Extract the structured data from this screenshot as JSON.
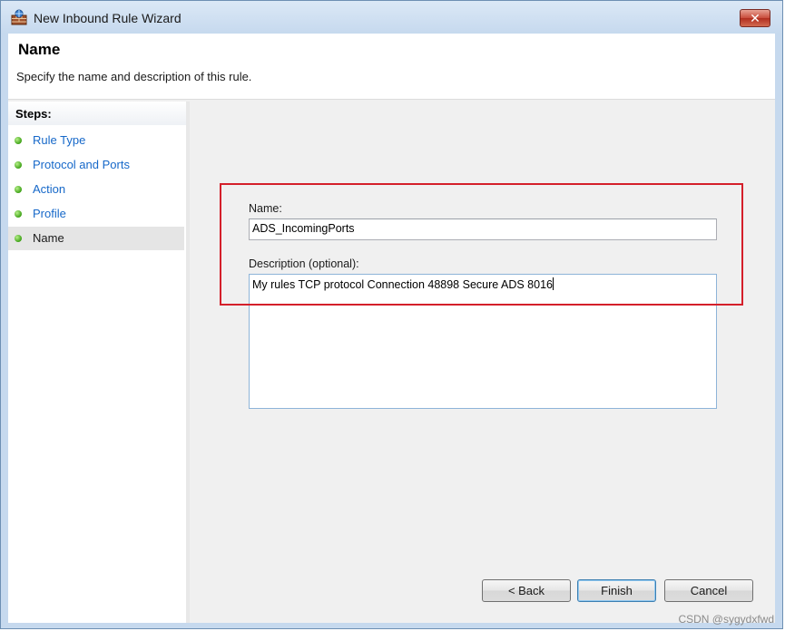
{
  "window": {
    "title": "New Inbound Rule Wizard",
    "close_label": "✕"
  },
  "header": {
    "title": "Name",
    "description": "Specify the name and description of this rule."
  },
  "steps": {
    "heading": "Steps:",
    "items": [
      {
        "label": "Rule Type",
        "active": false
      },
      {
        "label": "Protocol and Ports",
        "active": false
      },
      {
        "label": "Action",
        "active": false
      },
      {
        "label": "Profile",
        "active": false
      },
      {
        "label": "Name",
        "active": true
      }
    ]
  },
  "form": {
    "name_label": "Name:",
    "name_value": "ADS_IncomingPorts",
    "description_label": "Description (optional):",
    "description_value": "My rules TCP protocol Connection 48898 Secure ADS 8016"
  },
  "buttons": {
    "back": "< Back",
    "finish": "Finish",
    "cancel": "Cancel"
  },
  "watermark": "CSDN @sygydxfwd",
  "colors": {
    "highlight": "#d41f2a",
    "link": "#1668c9",
    "status_dot": "#3fa218"
  }
}
